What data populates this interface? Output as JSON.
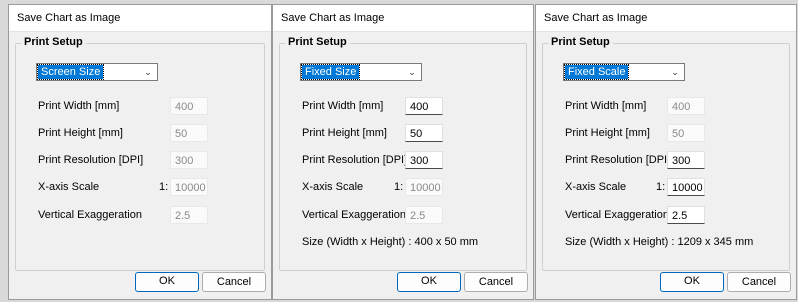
{
  "dialogs": [
    {
      "title": "Save Chart as Image",
      "group_label": "Print Setup",
      "mode": "Screen Size",
      "rows": [
        {
          "label": "Print Width [mm]",
          "value": "400",
          "enabled": false
        },
        {
          "label": "Print Height [mm]",
          "value": "50",
          "enabled": false
        },
        {
          "label": "Print Resolution [DPI]",
          "value": "300",
          "enabled": false
        },
        {
          "label": "X-axis Scale",
          "prefix": "1:",
          "value": "10000",
          "enabled": false
        },
        {
          "label": "Vertical Exaggeration",
          "value": "2.5",
          "enabled": false
        }
      ],
      "size_line": "",
      "ok_label": "OK",
      "cancel_label": "Cancel"
    },
    {
      "title": "Save Chart as Image",
      "group_label": "Print Setup",
      "mode": "Fixed Size",
      "rows": [
        {
          "label": "Print Width [mm]",
          "value": "400",
          "enabled": true
        },
        {
          "label": "Print Height [mm]",
          "value": "50",
          "enabled": true
        },
        {
          "label": "Print Resolution [DPI]",
          "value": "300",
          "enabled": true
        },
        {
          "label": "X-axis Scale",
          "prefix": "1:",
          "value": "10000",
          "enabled": false
        },
        {
          "label": "Vertical Exaggeration",
          "value": "2.5",
          "enabled": false
        }
      ],
      "size_line": "Size (Width x Height) : 400 x 50 mm",
      "ok_label": "OK",
      "cancel_label": "Cancel"
    },
    {
      "title": "Save Chart as Image",
      "group_label": "Print Setup",
      "mode": "Fixed Scale",
      "rows": [
        {
          "label": "Print Width [mm]",
          "value": "400",
          "enabled": false
        },
        {
          "label": "Print Height [mm]",
          "value": "50",
          "enabled": false
        },
        {
          "label": "Print Resolution [DPI]",
          "value": "300",
          "enabled": true
        },
        {
          "label": "X-axis Scale",
          "prefix": "1:",
          "value": "10000",
          "enabled": true
        },
        {
          "label": "Vertical Exaggeration",
          "value": "2.5",
          "enabled": true
        }
      ],
      "size_line": "Size (Width x Height) : 1209 x 345 mm",
      "ok_label": "OK",
      "cancel_label": "Cancel"
    }
  ],
  "icons": {
    "dropdown": "chevron-down-icon"
  },
  "colors": {
    "accent": "#0078d7",
    "primary_border": "#0067c0",
    "background": "#f0f0f0"
  }
}
